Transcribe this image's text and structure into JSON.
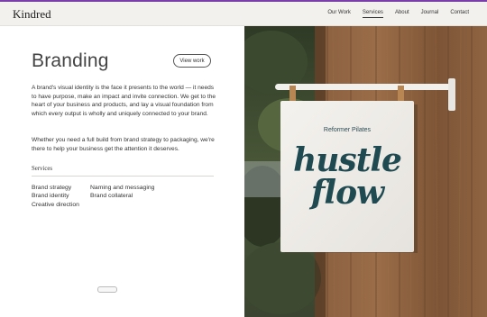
{
  "brand": {
    "name": "Kindred"
  },
  "nav": {
    "items": [
      {
        "label": "Our Work",
        "active": false
      },
      {
        "label": "Services",
        "active": true
      },
      {
        "label": "About",
        "active": false
      },
      {
        "label": "Journal",
        "active": false
      },
      {
        "label": "Contact",
        "active": false
      }
    ]
  },
  "page": {
    "title": "Branding",
    "view_work_label": "View work",
    "intro": "A brand's visual identity is the face it presents to the world — it needs to have purpose, make an impact and invite connection. We get to the heart of your business and products, and lay a visual foundation from which every output is wholly and uniquely connected to your brand.",
    "body": "Whether you need a full build from brand strategy to packaging, we're there to help your business get the attention it deserves.",
    "services_label": "Services",
    "services_col1": [
      "Brand strategy",
      "Brand identity",
      "Creative direction"
    ],
    "services_col2": [
      "Naming and messaging",
      "Brand collateral"
    ]
  },
  "sign": {
    "top_text": "Reformer Pilates",
    "line1": "hustle",
    "line2": "flow"
  },
  "colors": {
    "accent_bar": "#7a3fa8",
    "header_bg": "#f3f1ee",
    "sign_text": "#1f4a52"
  }
}
